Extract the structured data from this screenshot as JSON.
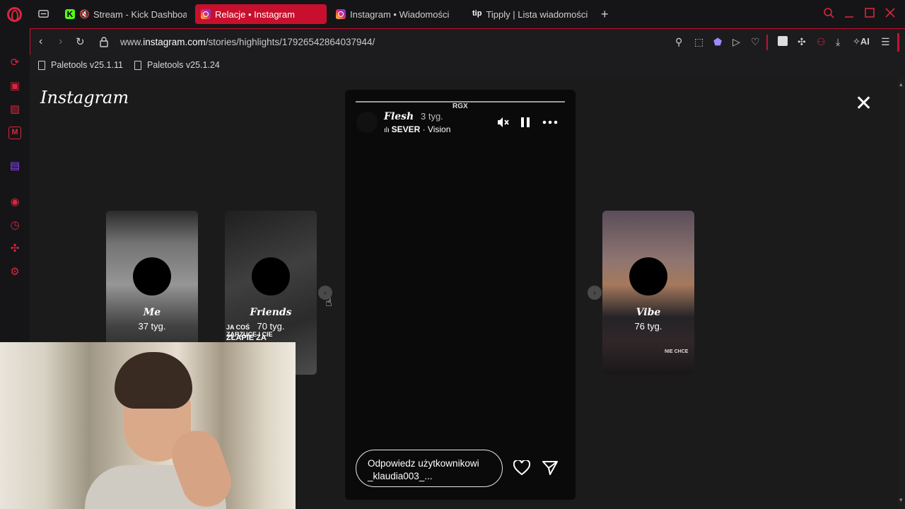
{
  "tabs": [
    {
      "label": "Stream - Kick Dashboa",
      "favicon": "kick-icon",
      "muted": true
    },
    {
      "label": "Relacje • Instagram",
      "favicon": "instagram-icon",
      "active": true
    },
    {
      "label": "Instagram • Wiadomości",
      "favicon": "instagram-icon"
    },
    {
      "label": "Tipply | Lista wiadomości",
      "favicon": "tipply-icon"
    }
  ],
  "tipply_glyph": "tip",
  "address": {
    "prefix": "www.",
    "domain": "instagram.com",
    "path": "/stories/highlights/17926542864037944/"
  },
  "toolbar": {
    "ai_label": "AI"
  },
  "bookmarks": [
    {
      "label": "Paletools v25.1.11"
    },
    {
      "label": "Paletools v25.1.24"
    }
  ],
  "instagram": {
    "logo": "Instagram",
    "highlights_left": [
      {
        "title": "Me",
        "age": "37 tyg."
      },
      {
        "title": "Friends",
        "age": "70 tyg.",
        "overlay_small": "JA COŚ\nZARZUCE I CIE",
        "overlay_big": "ZŁAPIE ZA"
      }
    ],
    "highlights_right": [
      {
        "title": "Vibe",
        "age": "76 tyg.",
        "overlay": "NIE CHCE"
      }
    ],
    "story": {
      "top_tag": "RGX",
      "user": "Flesh",
      "age": "3 tyg.",
      "music_artist": "SEVER",
      "music_sep": " · ",
      "music_track": "Vision",
      "reply_placeholder": "Odpowiedz użytkownikowi _klaudia003_..."
    }
  },
  "colors": {
    "accent": "#c8102e",
    "opera_red": "#d9263d",
    "twitch": "#9146ff"
  }
}
